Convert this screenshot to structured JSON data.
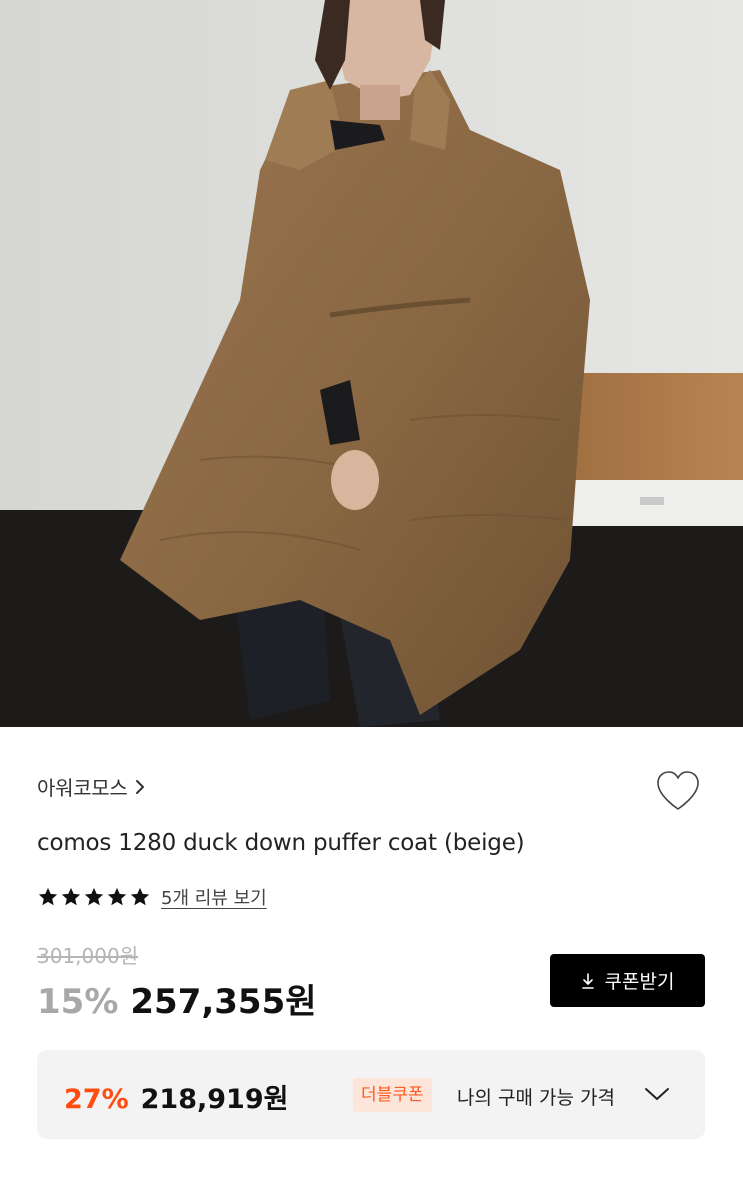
{
  "product_image": {
    "icon": "product-photo",
    "description_color_coat": "#8c6a45"
  },
  "brand": {
    "name": "아워코모스"
  },
  "product": {
    "title": "comos 1280 duck down puffer coat (beige)"
  },
  "rating": {
    "stars": 5,
    "max_stars": 5,
    "review_link": "5개 리뷰 보기"
  },
  "pricing": {
    "original_price": "301,000원",
    "discount_rate": "15%",
    "sale_price": "257,355원",
    "coupon_button_label": "쿠폰받기"
  },
  "my_price": {
    "rate": "27%",
    "price": "218,919원",
    "badge": "더블쿠폰",
    "label": "나의 구매 가능 가격"
  },
  "colors": {
    "accent_orange": "#ff4d12",
    "badge_bg": "#fde5da",
    "button_bg": "#000000"
  }
}
